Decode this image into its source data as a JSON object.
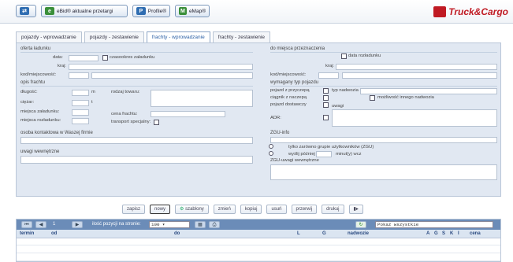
{
  "topbar": {
    "btn_ebid": "eBid® aktualne przetargi",
    "btn_profile": "Profile®",
    "btn_emap": "eMap®",
    "logo": "Truck&Cargo"
  },
  "tabs": [
    {
      "label": "pojazdy - wprowadzanie"
    },
    {
      "label": "pojazdy - zestawienie"
    },
    {
      "label": "frachty - wprowadzanie"
    },
    {
      "label": "frachty - zestawienie"
    }
  ],
  "form": {
    "oferta": {
      "title": "oferta ładunku",
      "date_label": "data:",
      "interval_label": "czasookres załadunku",
      "country_label": "kraj:",
      "postcode_label": "kod/miejscowość:"
    },
    "destination": {
      "title": "do miejsca przeznaczenia",
      "unload_date_label": "data rozładunku",
      "country_label": "kraj:",
      "postcode_label": "kod/miejscowość:"
    },
    "cargo": {
      "title": "opis frachtu",
      "length_label": "długość:",
      "length_unit": "m",
      "weight_label": "ciężar:",
      "weight_unit": "t",
      "load_places_label": "miejsca załadunku:",
      "unload_places_label": "miejsca rozładunku:",
      "goods_label": "rodzaj towaru:",
      "price_label": "cena frachtu:",
      "special_label": "transport specjalny:"
    },
    "vehicle": {
      "title": "wymagany typ pojazdu",
      "trailer_label": "pojazd z przyczepą",
      "body_label": "typ nadwozia",
      "tractor_label": "ciągnik z naczepą",
      "other_body_label": "możliwość innego nadwozia",
      "delivery_label": "pojazd dostawczy",
      "notes_label": "uwagi",
      "adr_label": "ADR:"
    },
    "contact_title": "osoba kontaktowa w Waszej firmie",
    "internal_notes_title": "uwagi wewnętrzne",
    "zgu": {
      "title": "ZGU-info",
      "option1": "tylko zarówno grupie użytkowników (ZGU)",
      "option2": "wyślij później",
      "option2_suffix": "minut(y) wcz",
      "notes_title": "ZGU-uwagi wewnętrzne"
    }
  },
  "actions": [
    "zapisz",
    "nowy",
    "szablony",
    "zmień",
    "kopiuj",
    "usuń",
    "przerwij",
    "drukuj"
  ],
  "grid": {
    "page": "1",
    "per_page_label": "ilość pozycji na stronie:",
    "per_page_value": "100",
    "filter_value": "Pokaż wszystkie",
    "columns": [
      "termin",
      "od",
      "do",
      "L",
      "G",
      "nadwozie",
      "A",
      "G",
      "S",
      "K",
      "I",
      "cena"
    ]
  }
}
